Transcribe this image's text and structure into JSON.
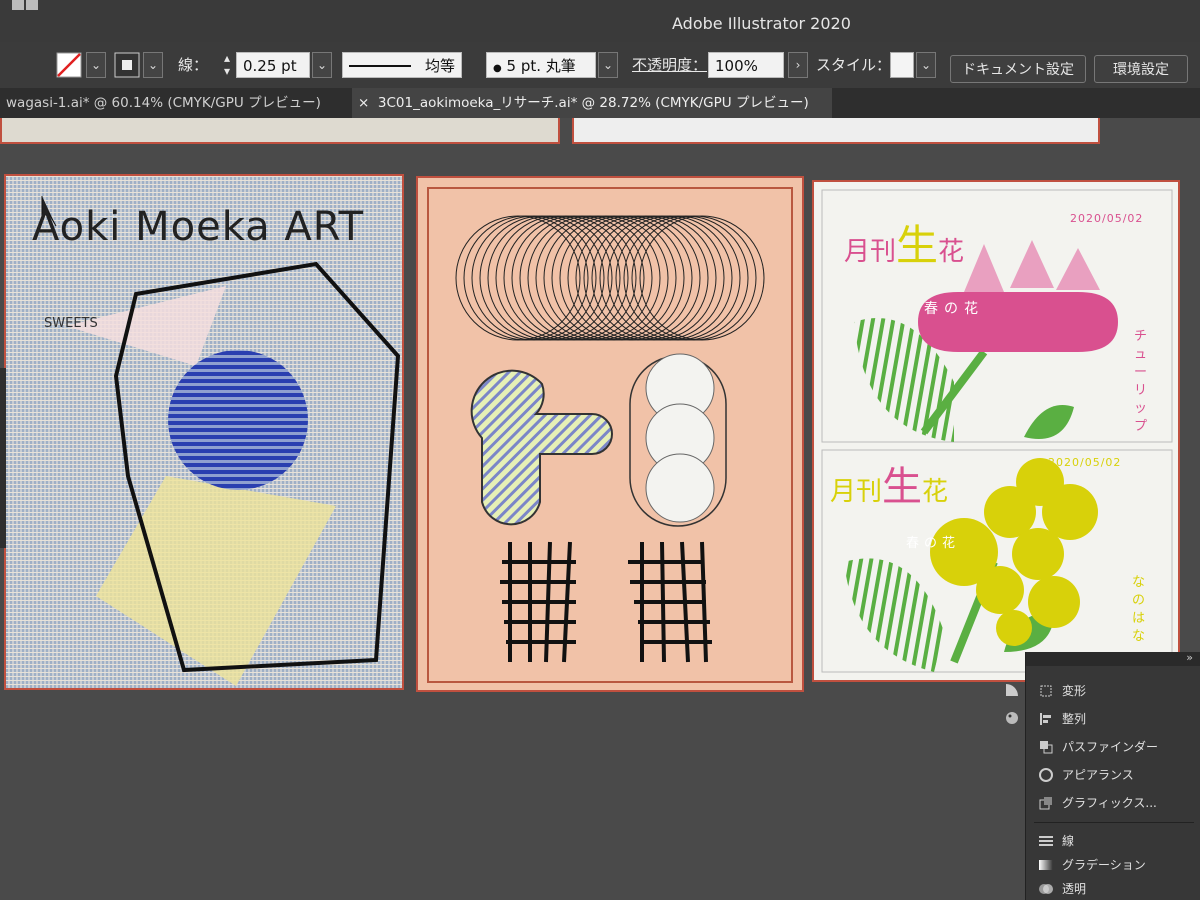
{
  "app": {
    "title": "Adobe Illustrator 2020"
  },
  "control_bar": {
    "stroke_label": "線：",
    "stroke_weight": "0.25 pt",
    "profile_label": "均等",
    "brush_label": "5 pt. 丸筆",
    "opacity_label": "不透明度：",
    "opacity_value": "100%",
    "style_label": "スタイル：",
    "document_settings": "ドキュメント設定",
    "preferences": "環境設定"
  },
  "tabs": [
    {
      "label": "wagasi-1.ai* @ 60.14% (CMYK/GPU プレビュー)",
      "active": false
    },
    {
      "close": "×",
      "label": "3C01_aokimoeka_リサーチ.ai* @ 28.72% (CMYK/GPU プレビュー)",
      "active": true
    }
  ],
  "artboards": {
    "a1": {
      "title": "Aoki Moeka ART",
      "subtitle": "SWEETS"
    },
    "a3": {
      "top": {
        "magazine": "月刊",
        "big": "生",
        "flower": "花",
        "date": "2020/05/02",
        "caption": "春の花",
        "vertical": "チューリップ"
      },
      "bottom": {
        "magazine": "月刊",
        "big": "生",
        "flower": "花",
        "date": "2020/05/02",
        "caption": "春の花",
        "vertical": "なのはな"
      }
    }
  },
  "panel": {
    "collapse": "»",
    "items": [
      {
        "label": "変形",
        "icon": "transform-icon"
      },
      {
        "label": "整列",
        "icon": "align-icon"
      },
      {
        "label": "パスファインダー",
        "icon": "pathfinder-icon"
      },
      {
        "label": "アピアランス",
        "icon": "appearance-icon"
      },
      {
        "label": "グラフィックス...",
        "icon": "graphic-styles-icon"
      },
      {
        "label": "線",
        "icon": "stroke-icon"
      },
      {
        "label": "グラデーション",
        "icon": "gradient-icon"
      },
      {
        "label": "透明",
        "icon": "transparency-icon"
      }
    ]
  },
  "colors": {
    "pink": "#d9508f",
    "yellow": "#d8d10a",
    "green": "#5aaf42",
    "blue": "#2a3fb0",
    "peach": "#f1c2a8"
  }
}
